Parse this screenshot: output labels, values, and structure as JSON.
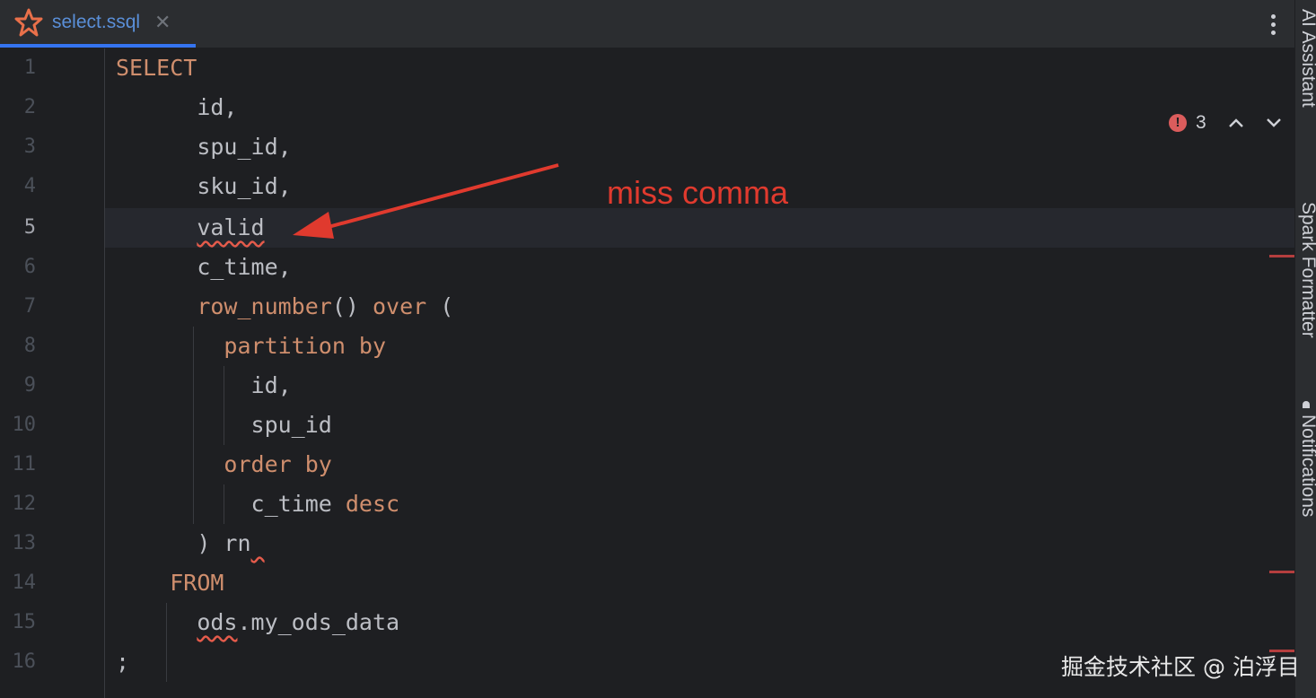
{
  "tab": {
    "file_name": "select.ssql",
    "close_glyph": "✕"
  },
  "inspection": {
    "error_count": "3",
    "up_glyph": "⌃",
    "down_glyph": "⌄",
    "error_glyph": "!"
  },
  "tool_window_labels": [
    "AI Assistant",
    "Spark Formatter",
    "Notifications"
  ],
  "gutter": {
    "line_numbers": [
      "1",
      "2",
      "3",
      "4",
      "5",
      "6",
      "7",
      "8",
      "9",
      "10",
      "11",
      "12",
      "13",
      "14",
      "15",
      "16"
    ],
    "current_line": "5"
  },
  "code_lines": [
    {
      "indent": "",
      "tokens": [
        {
          "t": "SELECT",
          "kw": true
        }
      ]
    },
    {
      "indent": "      ",
      "tokens": [
        {
          "t": "id,"
        }
      ]
    },
    {
      "indent": "      ",
      "tokens": [
        {
          "t": "spu_id,"
        }
      ]
    },
    {
      "indent": "      ",
      "tokens": [
        {
          "t": "sku_id,"
        }
      ]
    },
    {
      "indent": "      ",
      "tokens": [
        {
          "t": "valid",
          "err": true
        }
      ]
    },
    {
      "indent": "      ",
      "tokens": [
        {
          "t": "c_time,"
        }
      ]
    },
    {
      "indent": "      ",
      "tokens": [
        {
          "t": "row_number",
          "kw": true
        },
        {
          "t": "() "
        },
        {
          "t": "over",
          "kw": true
        },
        {
          "t": " ("
        }
      ]
    },
    {
      "indent": "        ",
      "tokens": [
        {
          "t": "partition by",
          "kw": true
        }
      ]
    },
    {
      "indent": "          ",
      "tokens": [
        {
          "t": "id,"
        }
      ]
    },
    {
      "indent": "          ",
      "tokens": [
        {
          "t": "spu_id"
        }
      ]
    },
    {
      "indent": "        ",
      "tokens": [
        {
          "t": "order by",
          "kw": true
        }
      ]
    },
    {
      "indent": "          ",
      "tokens": [
        {
          "t": "c_time "
        },
        {
          "t": "desc",
          "kw": true
        }
      ]
    },
    {
      "indent": "      ",
      "tokens": [
        {
          "t": ") rn"
        },
        {
          "t": " ",
          "err": true
        }
      ]
    },
    {
      "indent": "    ",
      "tokens": [
        {
          "t": "FROM",
          "kw": true
        }
      ]
    },
    {
      "indent": "      ",
      "tokens": [
        {
          "t": "ods",
          "err": true
        },
        {
          "t": ".my_ods_data"
        }
      ]
    },
    {
      "indent": "",
      "tokens": [
        {
          "t": ";"
        }
      ]
    }
  ],
  "annotation": {
    "text": "miss comma",
    "color": "#e03a2e"
  },
  "watermark": "掘金技术社区 @ 泊浮目",
  "colors": {
    "keyword": "#cf8e6d",
    "text": "#bcbec4",
    "error": "#db5c5c",
    "accent_tab": "#3574f0"
  }
}
